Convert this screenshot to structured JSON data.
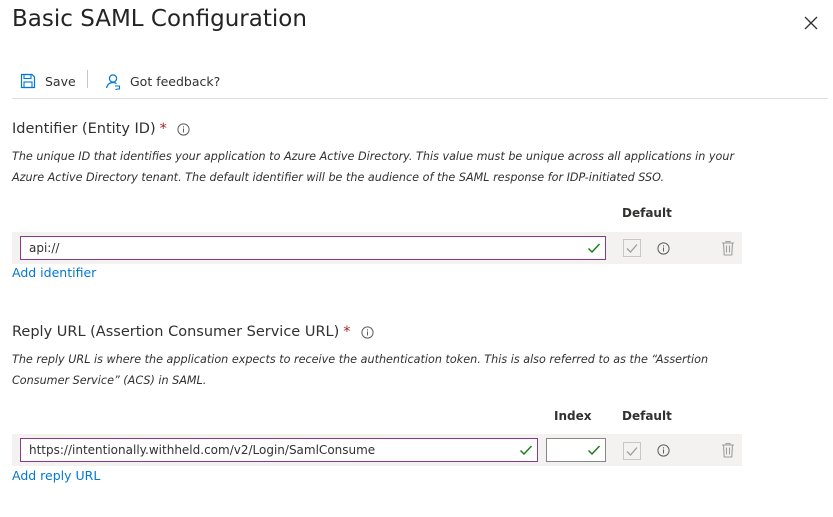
{
  "header": {
    "title": "Basic SAML Configuration"
  },
  "toolbar": {
    "save_label": "Save",
    "feedback_label": "Got feedback?"
  },
  "identifier": {
    "label": "Identifier (Entity ID)",
    "required_mark": "*",
    "description_line1": "The unique ID that identifies your application to Azure Active Directory. This value must be unique across all applications in your",
    "description_line2": "Azure Active Directory tenant. The default identifier will be the audience of the SAML response for IDP-initiated SSO.",
    "default_header": "Default",
    "value": "api://",
    "add_link": "Add identifier"
  },
  "reply_url": {
    "label": "Reply URL (Assertion Consumer Service URL)",
    "required_mark": "*",
    "description_line1": "The reply URL is where the application expects to receive the authentication token. This is also referred to as the “Assertion",
    "description_line2": "Consumer Service” (ACS) in SAML.",
    "index_header": "Index",
    "default_header": "Default",
    "value": "https://intentionally.withheld.com/v2/Login/SamlConsume",
    "index_value": "",
    "add_link": "Add reply URL"
  },
  "colors": {
    "accent": "#0078d4",
    "required": "#a4262c",
    "valid": "#107c10",
    "input_border": "#8a3a8e"
  }
}
